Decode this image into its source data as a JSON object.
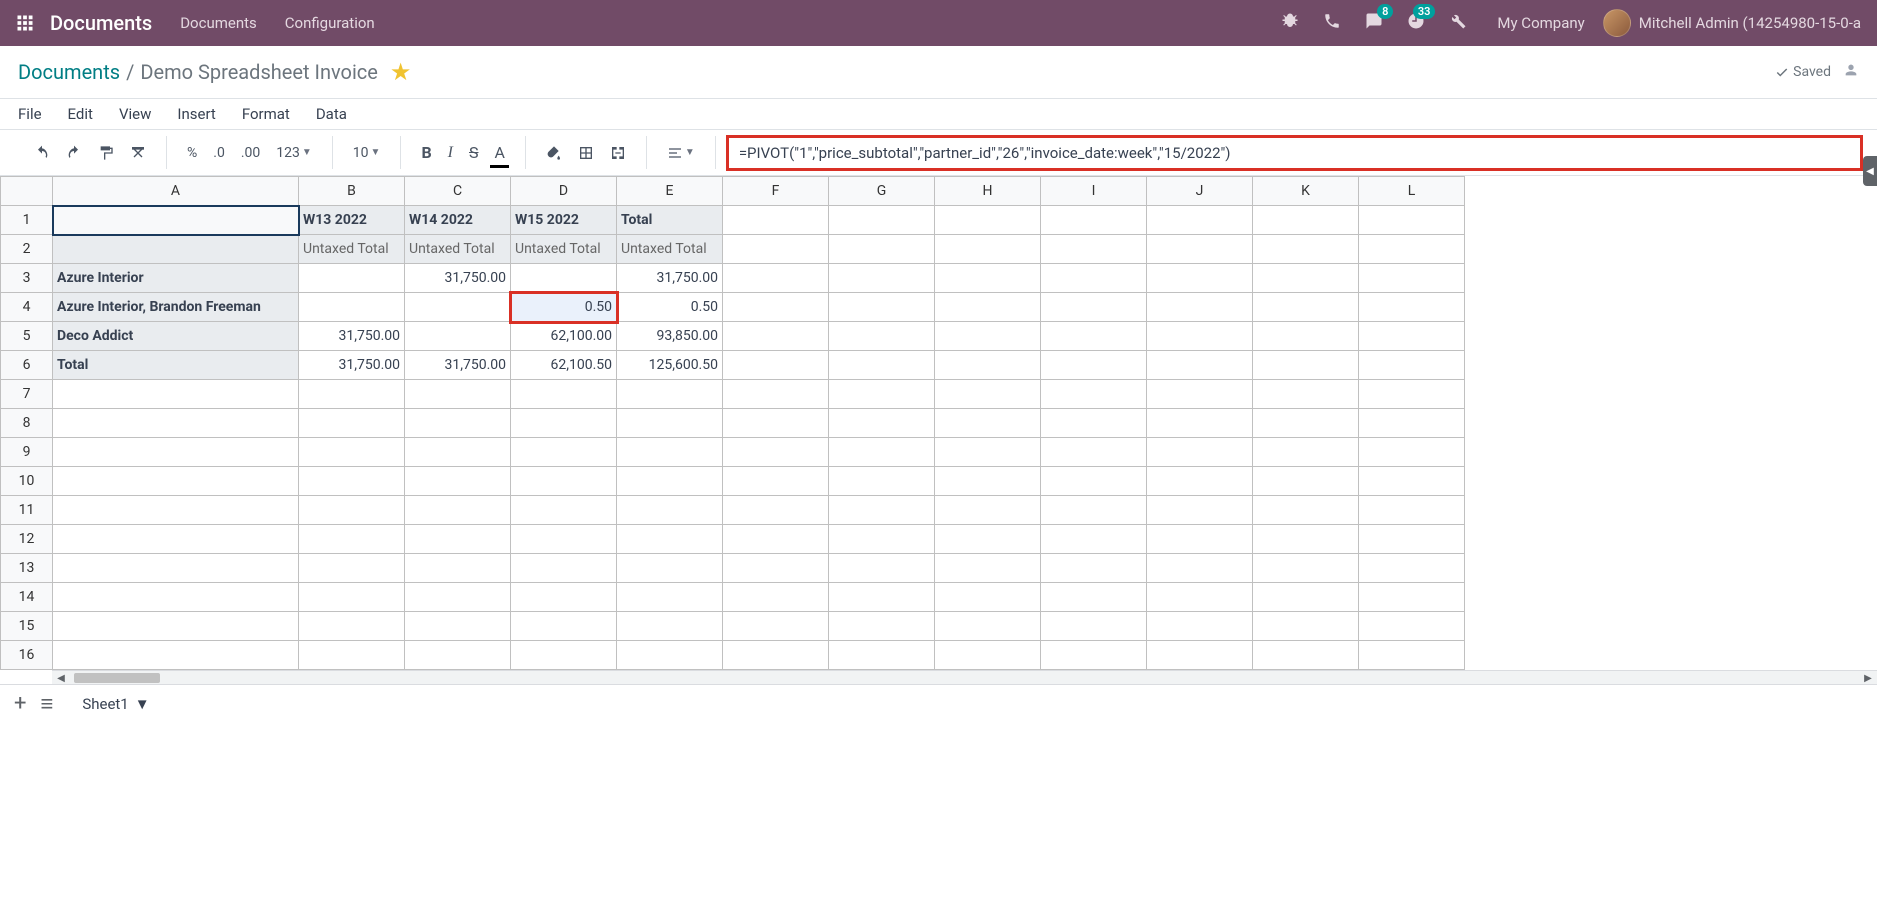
{
  "navbar": {
    "app_title": "Documents",
    "links": [
      "Documents",
      "Configuration"
    ],
    "msg_badge": "8",
    "activity_badge": "33",
    "company": "My Company",
    "username": "Mitchell Admin (14254980-15-0-a"
  },
  "breadcrumb": {
    "root": "Documents",
    "sep": "/",
    "current": "Demo Spreadsheet Invoice",
    "saved": "Saved"
  },
  "menubar": [
    "File",
    "Edit",
    "View",
    "Insert",
    "Format",
    "Data"
  ],
  "toolbar": {
    "pct": "%",
    "dec1": ".0",
    "dec2": ".00",
    "fmt": "123",
    "fontsize": "10",
    "bold": "B",
    "italic": "I",
    "strike": "S",
    "textcolor": "A"
  },
  "formula": "=PIVOT(\"1\",\"price_subtotal\",\"partner_id\",\"26\",\"invoice_date:week\",\"15/2022\")",
  "columns": [
    "A",
    "B",
    "C",
    "D",
    "E",
    "F",
    "G",
    "H",
    "I",
    "J",
    "K",
    "L"
  ],
  "rows": [
    "1",
    "2",
    "3",
    "4",
    "5",
    "6",
    "7",
    "8",
    "9",
    "10",
    "11",
    "12",
    "13",
    "14",
    "15",
    "16"
  ],
  "grid": {
    "r1": {
      "B": "W13 2022",
      "C": "W14 2022",
      "D": "W15 2022",
      "E": "Total"
    },
    "r2": {
      "B": "Untaxed Total",
      "C": "Untaxed Total",
      "D": "Untaxed Total",
      "E": "Untaxed Total"
    },
    "r3": {
      "A": "Azure Interior",
      "C": "31,750.00",
      "E": "31,750.00"
    },
    "r4": {
      "A": "Azure Interior, Brandon Freeman",
      "D": "0.50",
      "E": "0.50"
    },
    "r5": {
      "A": "Deco Addict",
      "B": "31,750.00",
      "D": "62,100.00",
      "E": "93,850.00"
    },
    "r6": {
      "A": "Total",
      "B": "31,750.00",
      "C": "31,750.00",
      "D": "62,100.50",
      "E": "125,600.50"
    }
  },
  "sheettab": "Sheet1"
}
